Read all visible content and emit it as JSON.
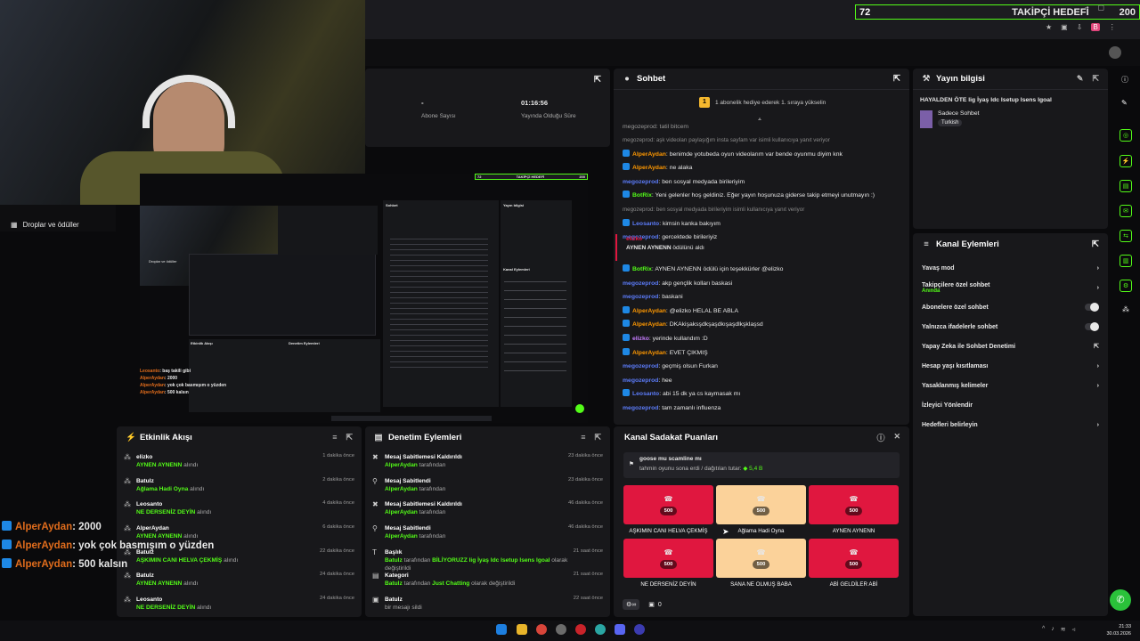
{
  "goal": {
    "count": "72",
    "label": "TAKİPÇİ HEDEFİ",
    "right": "200"
  },
  "left_nav": {
    "droplar": "Droplar ve ödüller"
  },
  "stats": {
    "dash": "-",
    "abone": "Abone Sayısı",
    "time": "01:16:56",
    "yayin": "Yayında Olduğu Süre"
  },
  "chat": {
    "title": "Sohbet",
    "pinned": "1 abonelik hediye ederek 1. sıraya yükselin",
    "top_fragment": "megozeprod: tatil bitcem",
    "lines": [
      {
        "type": "sys",
        "text": "megozeprod: aşk videoları paylaşığım insta sayfam var isimli kullanıcıya yanıt veriyor"
      },
      {
        "badge": true,
        "user": "AlperAydan",
        "color": "#ff9800",
        "text": "benimde yotubeda oyun videolarım var bende oyunmu diyim knk"
      },
      {
        "badge": true,
        "user": "AlperAydan",
        "color": "#ff9800",
        "text": "ne alaka"
      },
      {
        "badge": false,
        "user": "megozeprod",
        "color": "#5c7cfa",
        "text": "ben sosyal medyada birileriyim"
      },
      {
        "badge": true,
        "user": "BotRix",
        "color": "#53fc18",
        "text": "Yeni gelenler hoş geldiniz. Eğer yayın hoşunuza giderse takip etmeyi unutmayın :)"
      },
      {
        "type": "sys",
        "text": "megozeprod: ben sosyal medyada birileriyim isimli kullanıcıya yanıt veriyor"
      },
      {
        "badge": true,
        "user": "Leosanto",
        "color": "#5c7cfa",
        "text": "kimsin kanka bakıyım"
      },
      {
        "badge": false,
        "user": "megozeprod",
        "color": "#5c7cfa",
        "text": "gercektede birileriyiz"
      }
    ],
    "redeem": {
      "user": "elizko",
      "title": "AYNEN AYNENN",
      "suffix": "ödülünü aldı"
    },
    "lines2": [
      {
        "badge": true,
        "user": "BotRix",
        "color": "#53fc18",
        "text": "AYNEN AYNENN ödülü için teşekkürler @elizko"
      },
      {
        "badge": false,
        "user": "megozeprod",
        "color": "#5c7cfa",
        "text": "akp gençlik kolları baskasi"
      },
      {
        "badge": false,
        "user": "megozeprod",
        "color": "#5c7cfa",
        "text": "baskani"
      },
      {
        "badge": true,
        "user": "AlperAydan",
        "color": "#ff9800",
        "text": "@elizko HELAL BE ABLA"
      },
      {
        "badge": true,
        "user": "AlperAydan",
        "color": "#ff9800",
        "text": "DKAkişaksşdkşaşdkışaşdlkşklaşsd"
      },
      {
        "badge": true,
        "user": "elizko",
        "color": "#c77dff",
        "text": "yerinde kullandım :D"
      },
      {
        "badge": true,
        "user": "AlperAydan",
        "color": "#ff9800",
        "text": "EVET ÇIKMIŞ"
      },
      {
        "badge": false,
        "user": "megozeprod",
        "color": "#5c7cfa",
        "text": "geçmiş olsun Furkan"
      },
      {
        "badge": false,
        "user": "megozeprod",
        "color": "#5c7cfa",
        "text": "hee"
      },
      {
        "badge": true,
        "user": "Leosanto",
        "color": "#5c7cfa",
        "text": "abi 15 dk ya cs kaymasak mı"
      },
      {
        "badge": false,
        "user": "megozeprod",
        "color": "#5c7cfa",
        "text": "tam zamanlı influenza"
      }
    ]
  },
  "stream_info": {
    "title": "Yayın bilgisi",
    "stream_title": "HAYALDEN ÖTE lig İyaş Idc Isetup Isens Igoal",
    "category": "Sadece Sohbet",
    "tag": "Turkish"
  },
  "channel_actions": {
    "title": "Kanal Eylemleri",
    "items": [
      {
        "label": "Yavaş mod",
        "kind": "arrow"
      },
      {
        "label": "Takipçilere özel sohbet",
        "sub": "Anında",
        "kind": "arrow"
      },
      {
        "label": "Abonelere özel sohbet",
        "kind": "toggle"
      },
      {
        "label": "Yalnızca ifadelerle sohbet",
        "kind": "toggle"
      },
      {
        "label": "Yapay Zeka ile Sohbet Denetimi",
        "kind": "ext"
      },
      {
        "label": "Hesap yaşı kısıtlaması",
        "kind": "arrow"
      },
      {
        "label": "Yasaklanmış kelimeler",
        "kind": "arrow"
      },
      {
        "label": "İzleyici Yönlendir",
        "kind": "none"
      },
      {
        "label": "Hedefleri belirleyin",
        "kind": "arrow"
      }
    ]
  },
  "activity": {
    "title": "Etkinlik Akışı",
    "items": [
      {
        "user": "elizko",
        "reward": "AYNEN AYNENN",
        "suffix": "alındı",
        "time": "1 dakika önce"
      },
      {
        "user": "Batulz",
        "reward": "Ağlama Hadi Oyna",
        "suffix": "alındı",
        "time": "2 dakika önce"
      },
      {
        "user": "Leosanto",
        "reward": "NE DERSENİZ DEYİN",
        "suffix": "alındı",
        "time": "4 dakika önce"
      },
      {
        "user": "AlperAydan",
        "reward": "AYNEN AYNENN",
        "suffix": "alındı",
        "time": "6 dakika önce"
      },
      {
        "user": "Batulz",
        "reward": "AŞKIMIN CANI HELVA ÇEKMİŞ",
        "suffix": "alındı",
        "time": "22 dakika önce"
      },
      {
        "user": "Batulz",
        "reward": "AYNEN AYNENN",
        "suffix": "alındı",
        "time": "24 dakika önce"
      },
      {
        "user": "Leosanto",
        "reward": "NE DERSENİZ DEYİN",
        "suffix": "alındı",
        "time": "24 dakika önce"
      }
    ]
  },
  "moderation": {
    "title": "Denetim Eylemleri",
    "items": [
      {
        "action": "Mesaj Sabitlemesi Kaldırıldı",
        "by": "AlperAydan",
        "suffix": "tarafından",
        "time": "23 dakika önce"
      },
      {
        "action": "Mesaj Sabitlendi",
        "by": "AlperAydan",
        "suffix": "tarafından",
        "time": "23 dakika önce"
      },
      {
        "action": "Mesaj Sabitlemesi Kaldırıldı",
        "by": "AlperAydan",
        "suffix": "tarafından",
        "time": "46 dakika önce"
      },
      {
        "action": "Mesaj Sabitlendi",
        "by": "AlperAydan",
        "suffix": "tarafından",
        "time": "46 dakika önce"
      },
      {
        "action": "Başlık",
        "by": "Batulz",
        "suffix": "tarafından",
        "extra_pre": "BİLİYORUZZ lig İyaş Idc Isetup Isens Igoal",
        "extra_post": "olarak değiştirildi",
        "time": "21 saat önce"
      },
      {
        "action": "Kategori",
        "by": "Batulz",
        "suffix": "tarafından",
        "extra_pre": "Just Chatting",
        "extra_post": "olarak değiştirildi",
        "time": "21 saat önce"
      },
      {
        "action": "Batulz",
        "by": "",
        "suffix": "bir mesajı sildi",
        "time": "22 saat önce"
      }
    ]
  },
  "loyalty": {
    "title": "Kanal Sadakat Puanları",
    "pred_title": "goose mu scamline mı",
    "pred_text": "tahmin oyunu sona erdi / dağıtılan tutar:",
    "pred_amount": "5,4 B",
    "rewards": [
      {
        "label": "AŞKIMIN CANI HELVA ÇEKMİŞ",
        "cost": "500",
        "color": "#e0173f"
      },
      {
        "label": "Ağlama Hadi Oyna",
        "cost": "500",
        "color": "#fbd29a"
      },
      {
        "label": "AYNEN AYNENN",
        "cost": "500",
        "color": "#e0173f"
      },
      {
        "label": "NE DERSENİZ DEYİN",
        "cost": "500",
        "color": "#e0173f"
      },
      {
        "label": "SANA NE OLMUŞ BABA",
        "cost": "500",
        "color": "#fbd29a"
      },
      {
        "label": "ABİ GELDİLER ABİ",
        "cost": "500",
        "color": "#e0173f"
      }
    ],
    "footer_count": "0"
  },
  "overlay_chat": [
    {
      "user": "AlperAydan",
      "text": ": 2000"
    },
    {
      "user": "AlperAydan",
      "text": ": yok çok basmışım o yüzden"
    },
    {
      "user": "AlperAydan",
      "text": ": 500 kalsın"
    }
  ],
  "mini": {
    "goal": "TAKİPÇİ HEDEFİ",
    "count": "72",
    "right": "200",
    "mini_droplar": "Droplar ve ödüller",
    "mini_title": "Sohbet",
    "mini_info": "Yayın bilgisi",
    "mini_actions": "Kanal Eylemleri",
    "mini_feed": "Etkinlik Akışı",
    "mini_mod": "Denetim Eylemleri",
    "mini_chat": [
      {
        "user": "Leosanto",
        "text": ": baş takili gibi"
      },
      {
        "user": "AlperAydan",
        "text": ": 2000"
      },
      {
        "user": "AlperAydan",
        "text": ": yok çok basmışım o yüzden"
      },
      {
        "user": "AlperAydan",
        "text": ": 500 kalsın"
      }
    ]
  },
  "taskbar": {
    "time": "21:33",
    "date": "30.03.2026"
  }
}
